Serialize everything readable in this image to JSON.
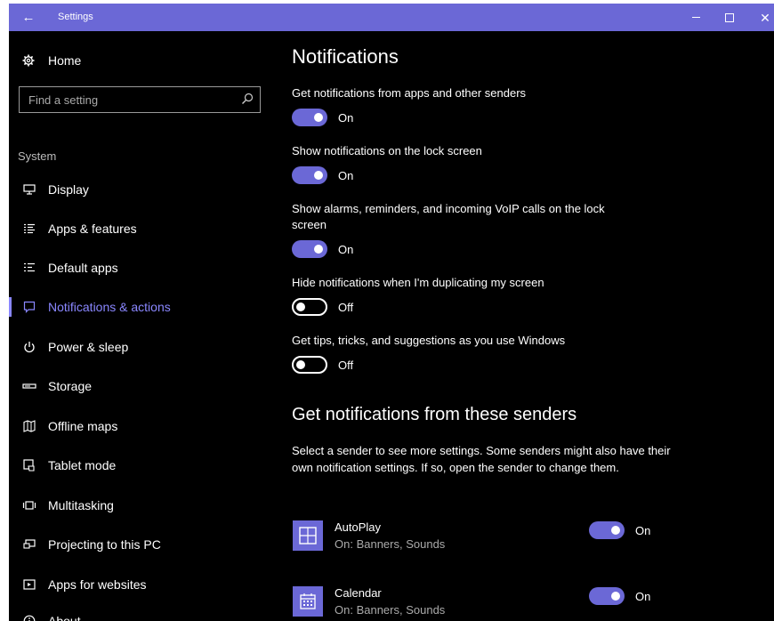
{
  "window": {
    "title": "Settings",
    "back_glyph": "←",
    "close_glyph": "✕"
  },
  "sidebar": {
    "home_label": "Home",
    "search_placeholder": "Find a setting",
    "section_label": "System",
    "items": [
      {
        "label": "Display",
        "icon": "monitor-icon"
      },
      {
        "label": "Apps & features",
        "icon": "list-icon"
      },
      {
        "label": "Default apps",
        "icon": "default-list-icon"
      },
      {
        "label": "Notifications & actions",
        "icon": "notification-icon",
        "selected": true
      },
      {
        "label": "Power & sleep",
        "icon": "power-icon"
      },
      {
        "label": "Storage",
        "icon": "storage-icon"
      },
      {
        "label": "Offline maps",
        "icon": "map-icon"
      },
      {
        "label": "Tablet mode",
        "icon": "tablet-icon"
      },
      {
        "label": "Multitasking",
        "icon": "multitask-icon"
      },
      {
        "label": "Projecting to this PC",
        "icon": "project-icon"
      },
      {
        "label": "Apps for websites",
        "icon": "web-app-icon"
      },
      {
        "label": "About",
        "icon": "info-icon"
      }
    ]
  },
  "main": {
    "title": "Notifications",
    "settings": [
      {
        "label": "Get notifications from apps and other senders",
        "state": "On"
      },
      {
        "label": "Show notifications on the lock screen",
        "state": "On"
      },
      {
        "label": "Show alarms, reminders, and incoming VoIP calls on the lock screen",
        "state": "On"
      },
      {
        "label": "Hide notifications when I'm duplicating my screen",
        "state": "Off"
      },
      {
        "label": "Get tips, tricks, and suggestions as you use Windows",
        "state": "Off"
      }
    ],
    "senders_title": "Get notifications from these senders",
    "senders_desc": "Select a sender to see more settings. Some senders might also have their own notification settings. If so, open the sender to change them.",
    "senders": [
      {
        "name": "AutoPlay",
        "status": "On: Banners, Sounds",
        "state": "On"
      },
      {
        "name": "Calendar",
        "status": "On: Banners, Sounds",
        "state": "On"
      }
    ]
  },
  "colors": {
    "accent": "#6b68d6",
    "selected_text": "#8a87ff",
    "background": "#000000"
  }
}
